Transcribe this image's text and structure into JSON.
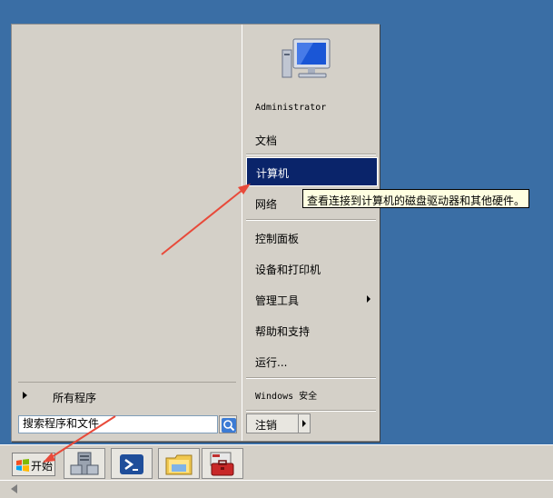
{
  "start_menu": {
    "all_programs_label": "所有程序",
    "search_placeholder": "搜索程序和文件",
    "right_items": {
      "user": "Administrator",
      "documents": "文档",
      "computer": "计算机",
      "network": "网络",
      "control_panel": "控制面板",
      "devices_printers": "设备和打印机",
      "admin_tools": "管理工具",
      "help_support": "帮助和支持",
      "run": "运行...",
      "windows_security": "Windows 安全"
    },
    "logout_label": "注销"
  },
  "tooltip": {
    "text": "查看连接到计算机的磁盘驱动器和其他硬件。"
  },
  "taskbar": {
    "start_label": "开始",
    "pinned_icons": [
      "server-manager-icon",
      "powershell-icon",
      "explorer-icon",
      "toolbox-icon"
    ]
  },
  "icons": {
    "avatar": "computer-monitor-icon",
    "search": "search-icon"
  },
  "colors": {
    "desktop": "#3a6ea5",
    "highlight": "#0a246a",
    "tooltip_bg": "#ffffe1",
    "annotation_arrow": "#e84a3a"
  }
}
